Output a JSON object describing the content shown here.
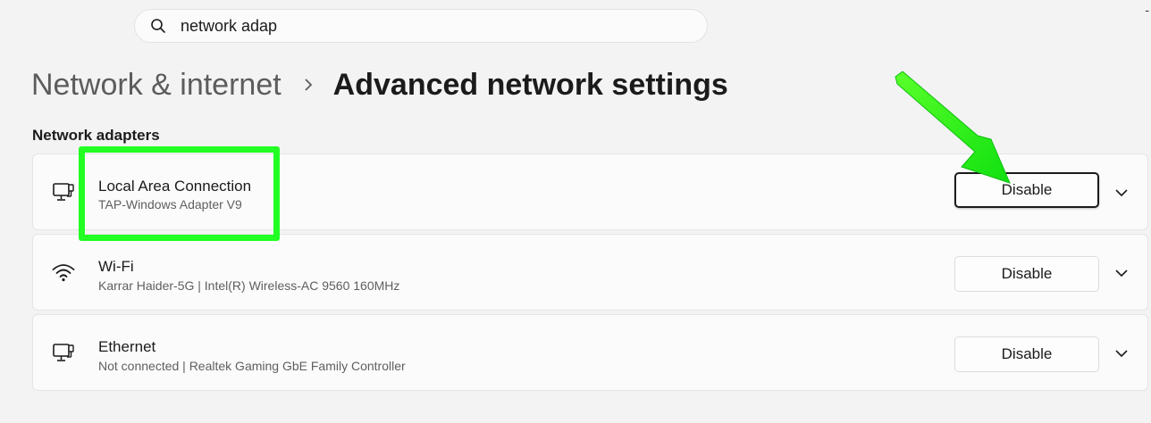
{
  "search": {
    "value": "network adap"
  },
  "window": {
    "corner_mark": "-"
  },
  "breadcrumb": {
    "parent": "Network & internet",
    "current": "Advanced network settings"
  },
  "section": {
    "title": "Network adapters"
  },
  "adapters": [
    {
      "name": "Local Area Connection",
      "description": "TAP-Windows Adapter V9",
      "button": "Disable",
      "icon": "network-monitor-icon"
    },
    {
      "name": "Wi-Fi",
      "description": "Karrar Haider-5G | Intel(R) Wireless-AC 9560 160MHz",
      "button": "Disable",
      "icon": "wifi-icon"
    },
    {
      "name": "Ethernet",
      "description": "Not connected | Realtek Gaming GbE Family Controller",
      "button": "Disable",
      "icon": "ethernet-icon"
    }
  ],
  "annotation": {
    "highlight_color": "#22ff22",
    "arrow_color": "#22ff22"
  }
}
